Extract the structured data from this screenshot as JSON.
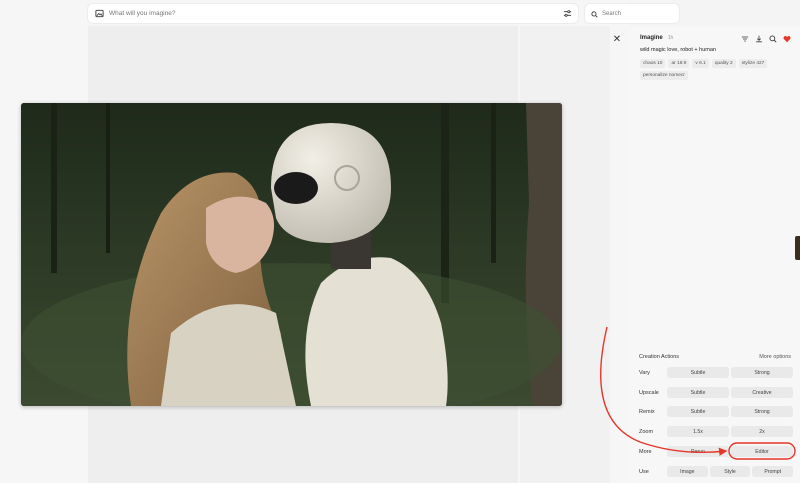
{
  "prompt_bar": {
    "placeholder": "What will you imagine?"
  },
  "search": {
    "placeholder": "Search"
  },
  "panel": {
    "title": "Imagine",
    "time": "1h",
    "prompt": "wild magic love, robot + human",
    "tags": [
      "chaos 10",
      "ar 16:9",
      "v 6.1",
      "quality 2",
      "stylize 427",
      "personalize nomecr"
    ],
    "icons": [
      "filter-icon",
      "download-icon",
      "search-icon",
      "heart-icon"
    ],
    "accent": "#e5362a"
  },
  "creation_actions": {
    "title": "Creation Actions",
    "more": "More options",
    "rows": [
      {
        "label": "Vary",
        "buttons": [
          "Subtle",
          "Strong"
        ]
      },
      {
        "label": "Upscale",
        "buttons": [
          "Subtle",
          "Creative"
        ]
      },
      {
        "label": "Remix",
        "buttons": [
          "Subtle",
          "Strong"
        ]
      },
      {
        "label": "Zoom",
        "buttons": [
          "1.5x",
          "2x"
        ]
      },
      {
        "label": "More",
        "buttons": [
          "Rerun",
          "Editor"
        ]
      },
      {
        "label": "Use",
        "buttons": [
          "Image",
          "Style",
          "Prompt"
        ]
      }
    ]
  },
  "annotation": {
    "color": "#e5362a",
    "highlighted": "Editor"
  }
}
